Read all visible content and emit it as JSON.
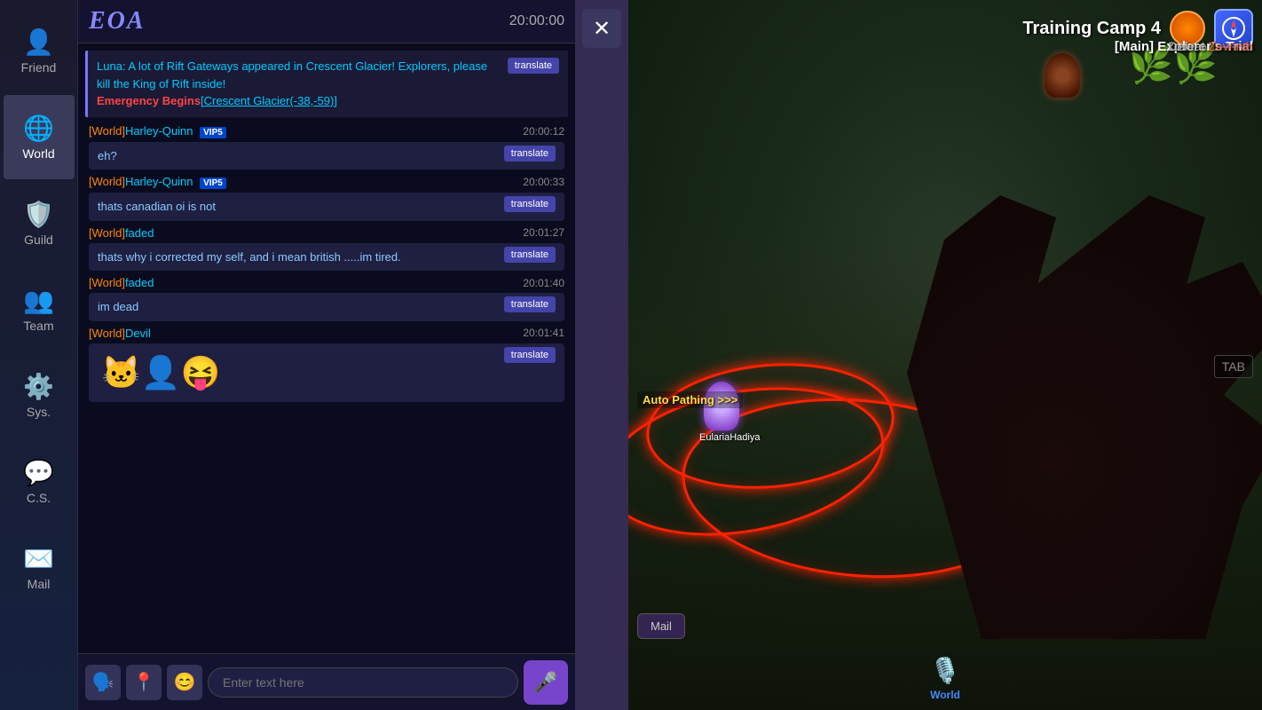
{
  "sidebar": {
    "items": [
      {
        "label": "Friend",
        "icon": "👤",
        "active": false
      },
      {
        "label": "World",
        "icon": "🌐",
        "active": true
      },
      {
        "label": "Guild",
        "icon": "🛡️",
        "active": false
      },
      {
        "label": "Team",
        "icon": "👥",
        "active": false
      },
      {
        "label": "Sys.",
        "icon": "⚙️",
        "active": false
      },
      {
        "label": "C.S.",
        "icon": "💬",
        "active": false
      },
      {
        "label": "Mail",
        "icon": "✉️",
        "active": false
      }
    ]
  },
  "chat": {
    "logo": "EOA",
    "timestamp_header": "20:00:00",
    "messages": [
      {
        "type": "system",
        "text": "Luna: A lot of Rift Gateways appeared in Crescent Glacier! Explorers, please kill the King of Rift inside!",
        "emergency_text": "Emergency Begins",
        "link_text": "[Crescent Glacier(-38,-59)]",
        "translate": true
      },
      {
        "type": "chat",
        "sender": "[World]Harley-Quinn",
        "vip": "VIP5",
        "time": "20:00:12",
        "text": "eh?",
        "translate": true
      },
      {
        "type": "chat",
        "sender": "[World]Harley-Quinn",
        "vip": "VIP5",
        "time": "20:00:33",
        "text": "thats canadian oi is not",
        "translate": true
      },
      {
        "type": "chat",
        "sender": "[World]faded",
        "vip": null,
        "time": "20:01:27",
        "text": "thats why i corrected my self, and i mean british .....im tired.",
        "translate": true
      },
      {
        "type": "chat",
        "sender": "[World]faded",
        "vip": null,
        "time": "20:01:40",
        "text": "im dead",
        "translate": true
      },
      {
        "type": "chat",
        "sender": "[World]Devil",
        "vip": null,
        "time": "20:01:41",
        "text": "🐱‍👤",
        "is_emoji": true,
        "translate": true
      }
    ]
  },
  "input": {
    "placeholder": "Enter text here"
  },
  "buttons": {
    "translate": "translate",
    "mic": "🎤",
    "close": "✕",
    "toolbar_icon": "🗣️",
    "location_icon": "📍",
    "emoji_icon": "😊",
    "auto_pathing": "Auto Pathing >>>",
    "mail": "Mail",
    "world_btn": "World",
    "tab": "TAB"
  },
  "hud": {
    "quest_title": "[Main] Explorer's Trial",
    "quest_subtitle": "Defeat",
    "quest_target": "Zevrinth",
    "training_title": "Training Camp  4",
    "player_name": "EulariaHadiya"
  }
}
